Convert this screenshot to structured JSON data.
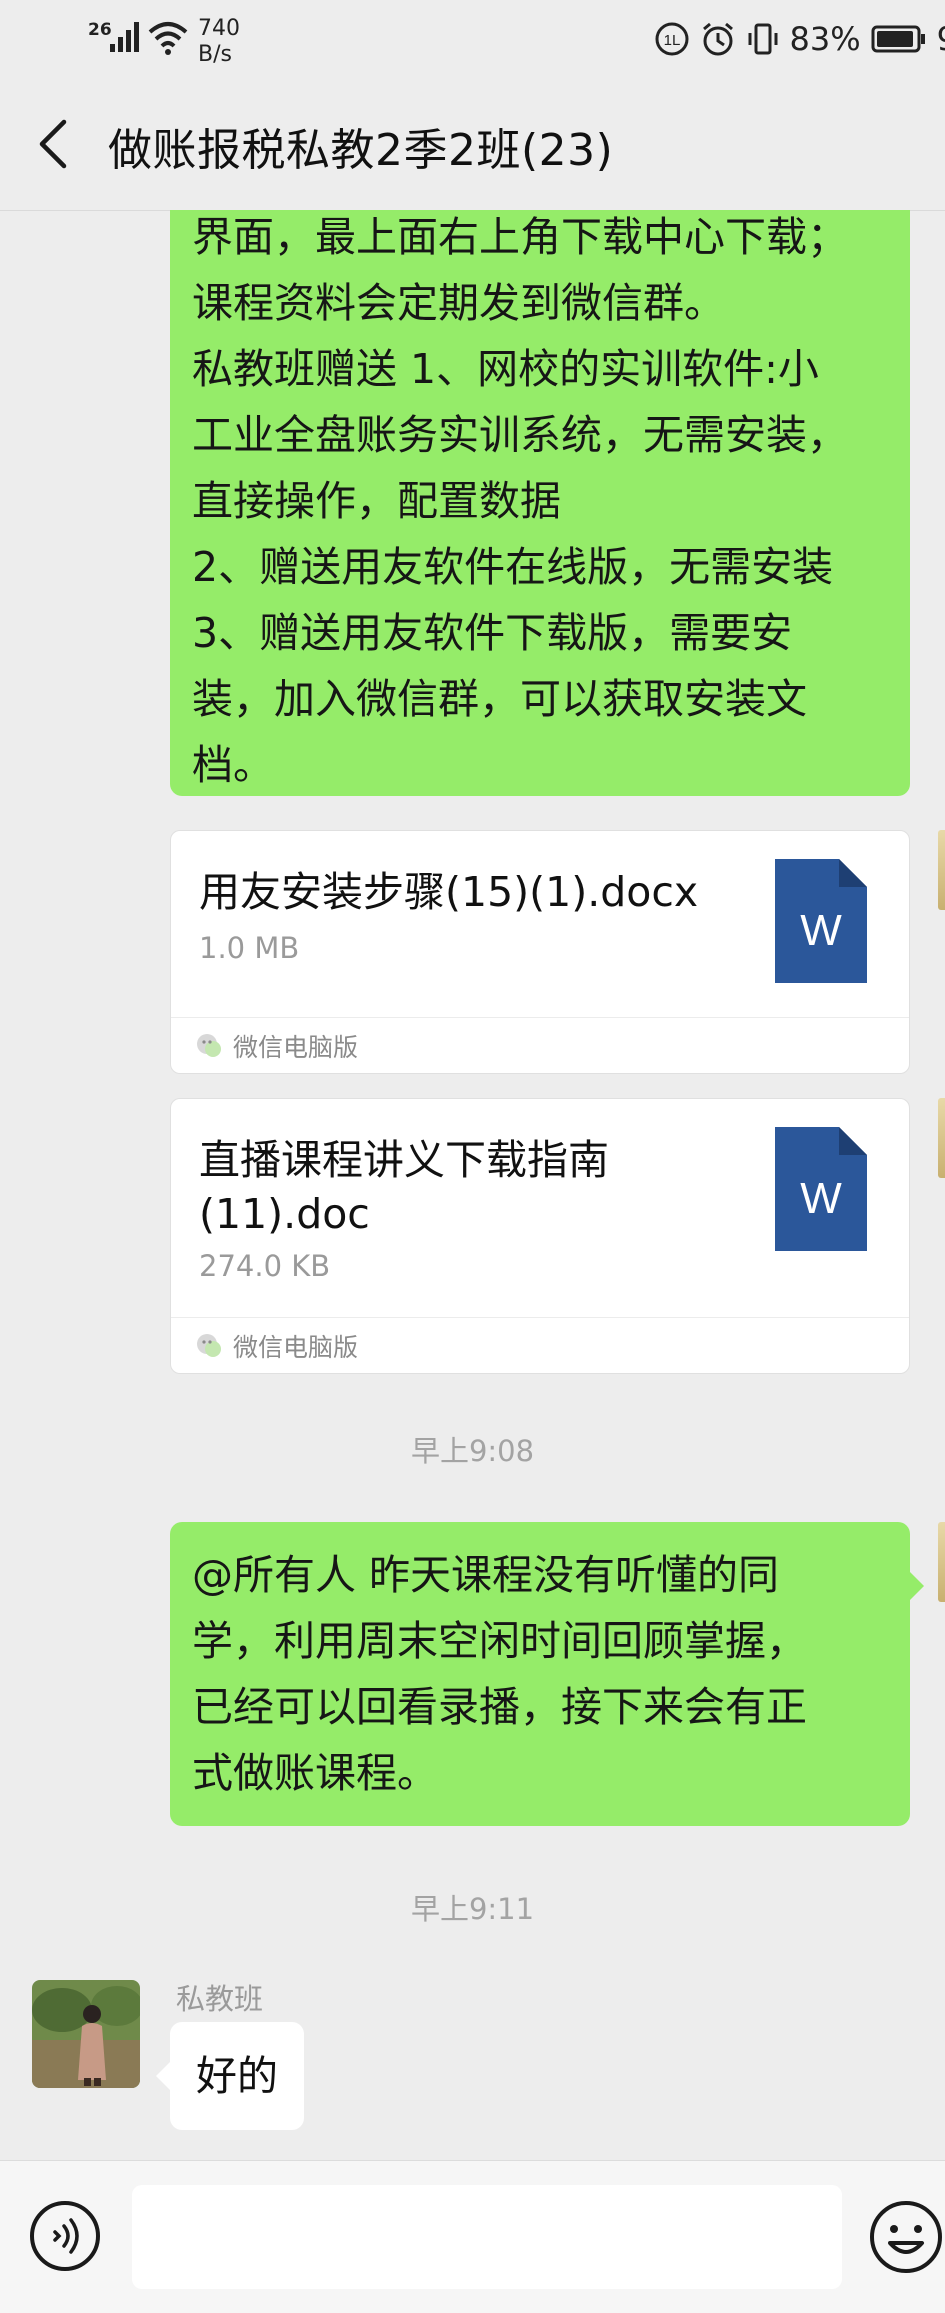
{
  "status_bar": {
    "network": "26",
    "speed_value": "740",
    "speed_unit": "B/s",
    "battery_percent": "83%",
    "time_partial": "9"
  },
  "header": {
    "title": "做账报税私教2季2班(23)"
  },
  "messages": {
    "announcement_lines": [
      "界面，最上面右上角下载中心下载；",
      "课程资料会定期发到微信群。",
      "私教班赠送 1、网校的实训软件:小",
      "工业全盘账务实训系统，无需安装，",
      "直接操作，配置数据",
      "2、赠送用友软件在线版，无需安装",
      "3、赠送用友软件下载版，需要安",
      "装，加入微信群，可以获取安装文",
      "档。"
    ],
    "file1": {
      "name": "用友安装步骤(15)(1).docx",
      "size": "1.0 MB",
      "source": "微信电脑版",
      "icon_letter": "W"
    },
    "file2": {
      "name": "直播课程讲义下载指南(11).doc",
      "size": "274.0 KB",
      "source": "微信电脑版",
      "icon_letter": "W"
    },
    "time1": "早上9:08",
    "notice_lines": [
      "@所有人  昨天课程没有听懂的同",
      "学，利用周末空闲时间回顾掌握，",
      "已经可以回看录播，接下来会有正",
      "式做账课程。"
    ],
    "time2": "早上9:11",
    "reply": {
      "sender": "私教班",
      "text": "好的"
    }
  },
  "colors": {
    "sent_bubble": "#95ec69",
    "word_icon": "#2b579a",
    "background": "#ededed"
  }
}
